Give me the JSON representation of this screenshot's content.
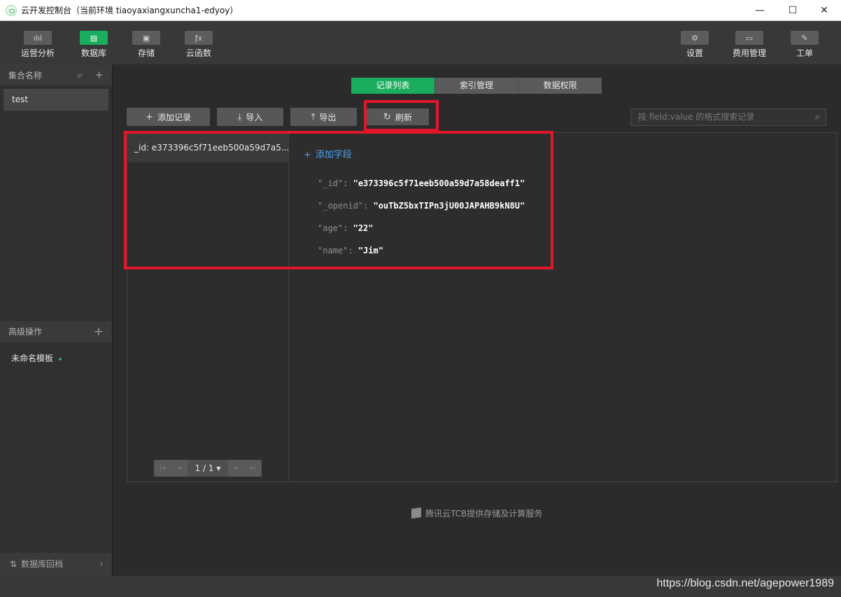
{
  "window": {
    "title": "云开发控制台（当前环境 tiaoyaxiangxuncha1-edyoy）",
    "minimize": "—",
    "maximize": "☐",
    "close": "✕"
  },
  "toolbar": {
    "left": [
      {
        "label": "运营分析",
        "icon": "ılıl"
      },
      {
        "label": "数据库",
        "icon": "▤"
      },
      {
        "label": "存储",
        "icon": "▣"
      },
      {
        "label": "云函数",
        "icon": "ƒx"
      }
    ],
    "right": [
      {
        "label": "设置",
        "icon": "⚙"
      },
      {
        "label": "费用管理",
        "icon": "▭"
      },
      {
        "label": "工单",
        "icon": "✎"
      }
    ]
  },
  "sidebar": {
    "collections_header": "集合名称",
    "collections": [
      "test"
    ],
    "advanced_header": "高级操作",
    "templates": [
      "未命名模板"
    ],
    "footer": "数据库回档"
  },
  "main": {
    "tabs": [
      "记录列表",
      "索引管理",
      "数据权限"
    ],
    "actions": {
      "add_record": "添加记录",
      "import": "导入",
      "export": "导出",
      "refresh": "刷新"
    },
    "search_placeholder": "按 field:value 的格式搜索记录",
    "records": [
      "_id: e373396c5f71eeb500a59d7a5..."
    ],
    "pager": "1 / 1 ▾",
    "add_field": "添加字段",
    "fields": [
      {
        "key": "\"_id\":",
        "value": "\"e373396c5f71eeb500a59d7a58deaff1\""
      },
      {
        "key": "\"_openid\":",
        "value": "\"ouTbZ5bxTIPn3jU00JAPAHB9kN8U\""
      },
      {
        "key": "\"age\":",
        "value": "\"22\""
      },
      {
        "key": "\"name\":",
        "value": "\"Jim\""
      }
    ],
    "footnote": "腾讯云TCB提供存储及计算服务"
  },
  "watermark": "https://blog.csdn.net/agepower1989"
}
